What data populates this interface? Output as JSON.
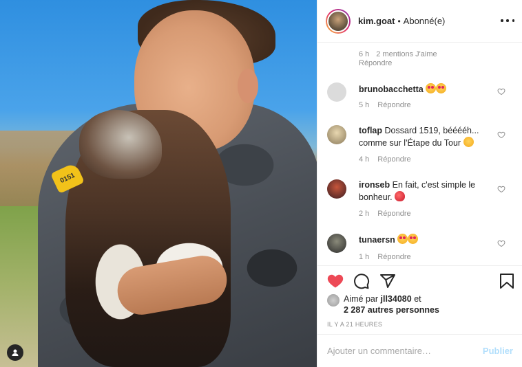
{
  "post": {
    "username": "kim.goat",
    "separator": "•",
    "follow_status": "Abonné(e)",
    "photo_tag": "0151",
    "top_comment_meta": {
      "time": "6 h",
      "likes": "2 mentions J'aime",
      "reply": "Répondre"
    }
  },
  "comments": [
    {
      "user": "brunobacchetta",
      "text": "",
      "emoji": [
        "heart-eyes",
        "heart-eyes"
      ],
      "time": "5 h",
      "reply": "Répondre"
    },
    {
      "user": "toflap",
      "text": "Dossard 1519, bééééh... comme sur l'Étape du Tour",
      "emoji": [
        "smile"
      ],
      "time": "4 h",
      "reply": "Répondre"
    },
    {
      "user": "ironseb",
      "text": "En fait, c'est simple le bonheur.",
      "emoji": [
        "balloon"
      ],
      "time": "2 h",
      "reply": "Répondre"
    },
    {
      "user": "tunaersn",
      "text": "",
      "emoji": [
        "heart-eyes",
        "heart-eyes"
      ],
      "time": "1 h",
      "reply": "Répondre"
    }
  ],
  "likes": {
    "prefix": "Aimé par",
    "user": "jll34080",
    "connector": "et",
    "others": "2 287 autres personnes"
  },
  "time_ago": "IL Y A 21 HEURES",
  "add_comment": {
    "placeholder": "Ajouter un commentaire…",
    "post_label": "Publier"
  },
  "colors": {
    "like_red": "#ed4956",
    "post_blue": "#b2dffc",
    "text": "#262626",
    "muted": "#8e8e8e"
  },
  "icons": [
    "heart-filled-icon",
    "comment-icon",
    "share-icon",
    "bookmark-icon",
    "more-icon",
    "user-tag-icon"
  ]
}
